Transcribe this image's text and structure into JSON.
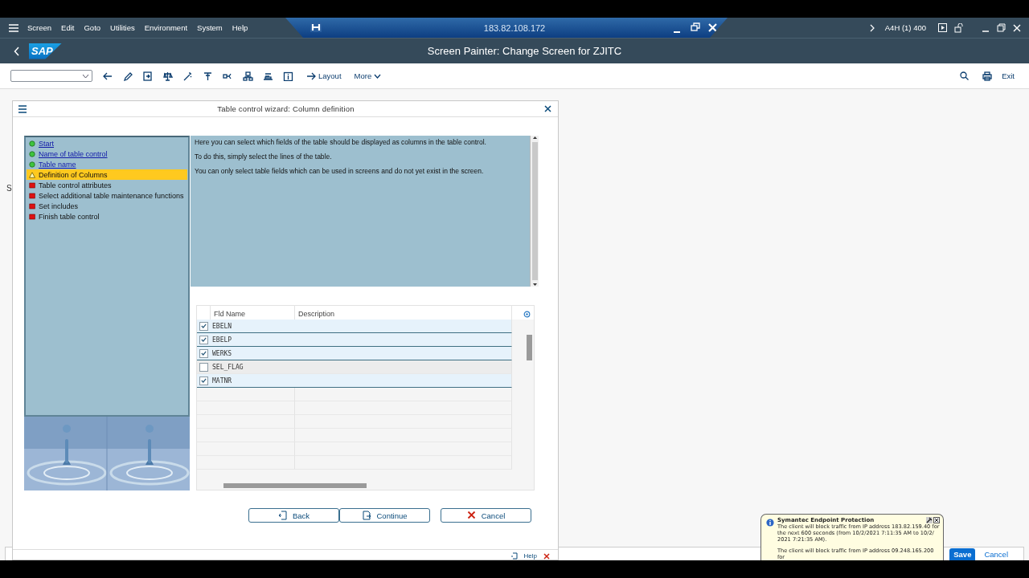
{
  "menu": [
    "Screen",
    "Edit",
    "Goto",
    "Utilities",
    "Environment",
    "System",
    "Help"
  ],
  "connection": {
    "host": "183.82.108.172"
  },
  "session": "A4H (1) 400",
  "logo": "SAP",
  "title": "Screen Painter: Change Screen for ZJITC",
  "toolbar": {
    "layout": "Layout",
    "more": "More",
    "exit": "Exit"
  },
  "background_text": "S",
  "dialog": {
    "title": "Table control wizard: Column definition",
    "steps": [
      {
        "label": "Start",
        "kind": "done",
        "selected": false
      },
      {
        "label": "Name of table control",
        "kind": "done",
        "selected": false
      },
      {
        "label": "Table name",
        "kind": "done",
        "selected": false
      },
      {
        "label": "Definition of Columns",
        "kind": "current",
        "selected": true
      },
      {
        "label": "Table control attributes",
        "kind": "todo",
        "selected": false
      },
      {
        "label": "Select additional table maintenance functions",
        "kind": "todo",
        "selected": false
      },
      {
        "label": "Set includes",
        "kind": "todo",
        "selected": false
      },
      {
        "label": "Finish table control",
        "kind": "todo",
        "selected": false
      }
    ],
    "info": [
      "Here you can select which fields of the table should be displayed as columns in the table control.",
      "To do this, simply select the lines of the table.",
      "You can only select table fields which can be used in screens and do not yet exist in the screen."
    ],
    "columns": [
      "Fld Name",
      "Description"
    ],
    "fields": [
      {
        "name": "EBELN",
        "checked": true
      },
      {
        "name": "EBELP",
        "checked": true
      },
      {
        "name": "WERKS",
        "checked": true
      },
      {
        "name": "SEL_FLAG",
        "checked": false
      },
      {
        "name": "MATNR",
        "checked": true
      }
    ],
    "buttons": [
      {
        "label": "Back",
        "kind": "back"
      },
      {
        "label": "Continue",
        "kind": "continue"
      },
      {
        "label": "Cancel",
        "kind": "cancel"
      }
    ],
    "help": "Help"
  },
  "notification": {
    "title": "Symantec Endpoint Protection",
    "lines": [
      "The client will block traffic from IP address 183.82.159.40 for the next 600 seconds (from 10/2/2021 7:11:35 AM to 10/2/ 2021 7:21:35 AM).",
      "The client will block traffic from IP address 09.248.165.200 for"
    ]
  },
  "footer_buttons": [
    {
      "label": "Save",
      "kind": "primary"
    },
    {
      "label": "Cancel",
      "kind": "plain"
    }
  ]
}
